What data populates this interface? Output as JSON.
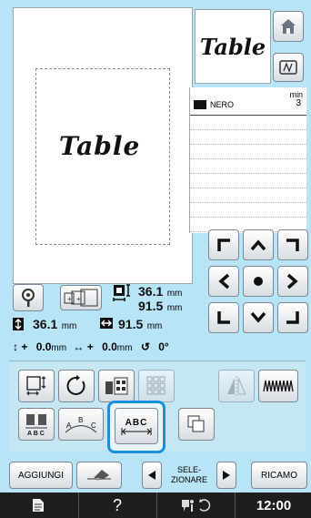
{
  "preview": {
    "pattern_text": "Table"
  },
  "thumbnail": {
    "pattern_text": "Table"
  },
  "thread": {
    "color_name": "NERO",
    "color_hex": "#111111",
    "time_label": "min",
    "time_value": "3"
  },
  "size_info": {
    "height_value": "36.1",
    "height_unit": "mm",
    "width_value": "91.5",
    "width_unit": "mm",
    "row_height": "36.1",
    "row_height_unit": "mm",
    "row_width": "91.5",
    "row_width_unit": "mm",
    "offset_v_sign": "+",
    "offset_v": "0.0",
    "offset_v_unit": "mm",
    "offset_h_sign": "+",
    "offset_h": "0.0",
    "offset_h_unit": "mm",
    "rotation": "0°"
  },
  "buttons": {
    "aggiungi": "AGGIUNGI",
    "seleziona_line1": "SELE-",
    "seleziona_line2": "ZIONARE",
    "ricamo": "RICAMO",
    "abc": "ABC"
  },
  "footer": {
    "help": "?",
    "clock": "12:00"
  },
  "icons": {
    "home": "home-icon",
    "hoop": "hoop-icon",
    "zoom": "zoom-icon",
    "arrow_up": "arrow-up-icon",
    "arrow_down": "arrow-down-icon",
    "arrow_left": "arrow-left-icon",
    "arrow_right": "arrow-right-icon"
  },
  "colors": {
    "background": "#b8e4f7",
    "selected_outline": "#1a8fe0",
    "footer": "#1e1e1e"
  }
}
